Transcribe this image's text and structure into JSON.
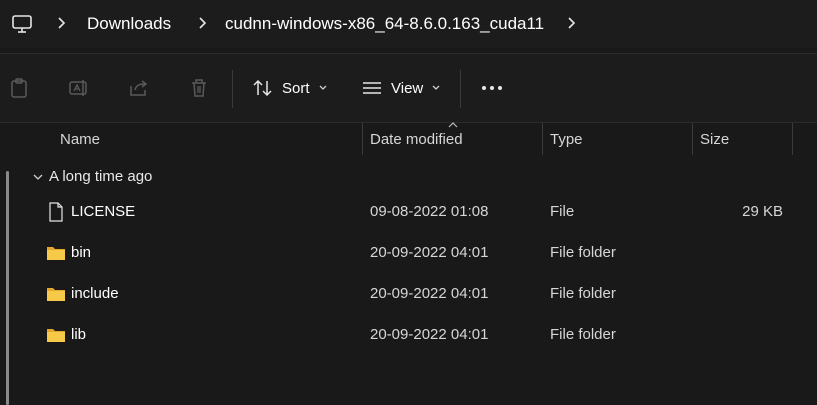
{
  "breadcrumb": {
    "root_icon": "computer-icon",
    "items": [
      "Downloads",
      "cudnn-windows-x86_64-8.6.0.163_cuda11"
    ]
  },
  "toolbar": {
    "icons": [
      "paste-icon",
      "rename-icon",
      "share-icon",
      "delete-icon"
    ],
    "sort_label": "Sort",
    "view_label": "View",
    "more_icon": "more-options-icon"
  },
  "columns": {
    "name": "Name",
    "date": "Date modified",
    "type": "Type",
    "size": "Size"
  },
  "group": {
    "label": "A long time ago"
  },
  "files": [
    {
      "name": "LICENSE",
      "date": "09-08-2022 01:08",
      "type": "File",
      "size": "29 KB",
      "icon": "file-icon"
    },
    {
      "name": "bin",
      "date": "20-09-2022 04:01",
      "type": "File folder",
      "size": "",
      "icon": "folder-icon"
    },
    {
      "name": "include",
      "date": "20-09-2022 04:01",
      "type": "File folder",
      "size": "",
      "icon": "folder-icon"
    },
    {
      "name": "lib",
      "date": "20-09-2022 04:01",
      "type": "File folder",
      "size": "",
      "icon": "folder-icon"
    }
  ],
  "colors": {
    "background": "#191919",
    "folder": "#f7c948",
    "text": "#ffffff"
  }
}
